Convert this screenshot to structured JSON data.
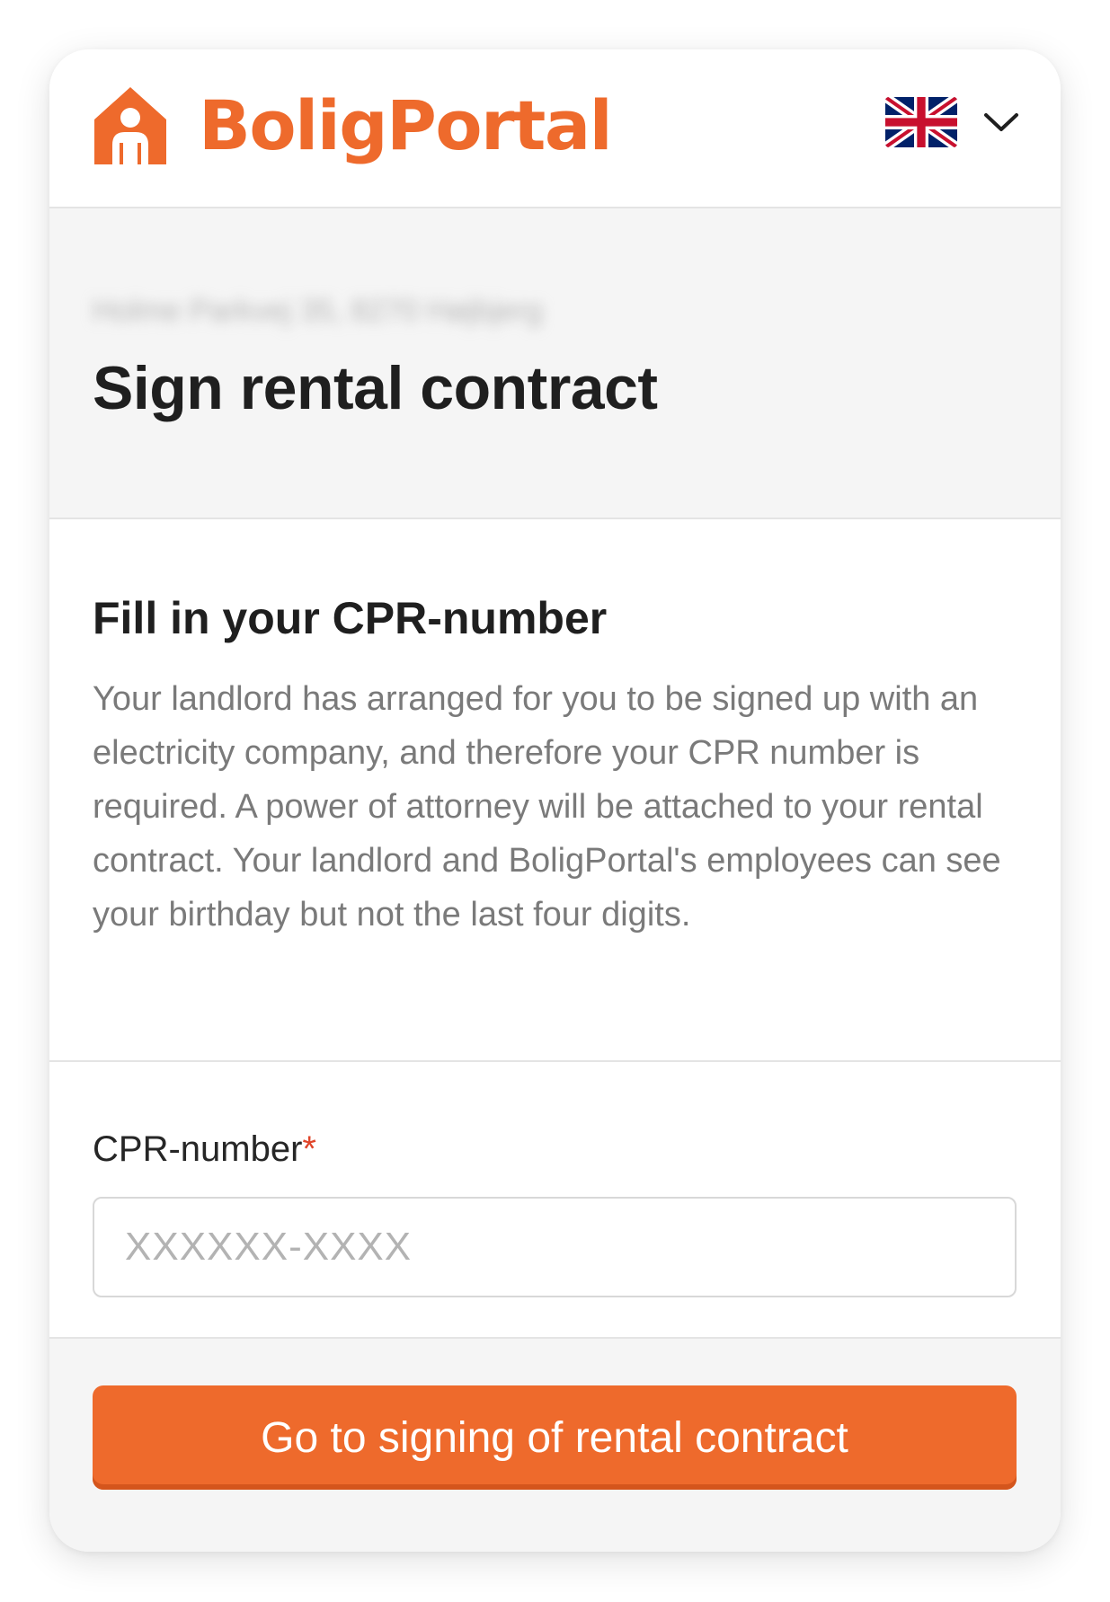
{
  "brand": {
    "name": "BoligPortal",
    "accent_color": "#ee6a2c",
    "logo_icon": "house-person-icon"
  },
  "language": {
    "selected": "English",
    "flag_icon": "uk-flag-icon",
    "toggle_icon": "chevron-down-icon"
  },
  "hero": {
    "address": "Holme Parkvej 35, 8270 Højbjerg",
    "title": "Sign rental contract"
  },
  "info": {
    "heading": "Fill in your CPR-number",
    "body": "Your landlord has arranged for you to be signed up with an electricity company, and therefore your CPR number is required. A power of attorney will be attached to your rental contract. Your landlord and BoligPortal's employees can see your birthday but not the last four digits."
  },
  "form": {
    "cpr_label": "CPR-number",
    "required_marker": "*",
    "cpr_value": "",
    "cpr_placeholder": "XXXXXX-XXXX"
  },
  "actions": {
    "submit_label": "Go to signing of rental contract"
  }
}
